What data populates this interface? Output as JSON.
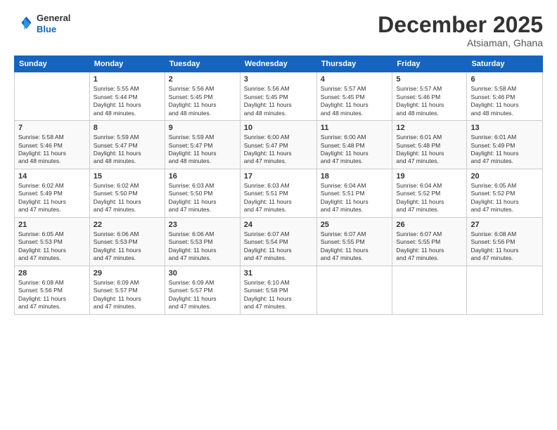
{
  "logo": {
    "line1": "General",
    "line2": "Blue"
  },
  "title": "December 2025",
  "subtitle": "Atsiaman, Ghana",
  "days_of_week": [
    "Sunday",
    "Monday",
    "Tuesday",
    "Wednesday",
    "Thursday",
    "Friday",
    "Saturday"
  ],
  "weeks": [
    [
      {
        "day": "",
        "info": ""
      },
      {
        "day": "1",
        "info": "Sunrise: 5:55 AM\nSunset: 5:44 PM\nDaylight: 11 hours\nand 48 minutes."
      },
      {
        "day": "2",
        "info": "Sunrise: 5:56 AM\nSunset: 5:45 PM\nDaylight: 11 hours\nand 48 minutes."
      },
      {
        "day": "3",
        "info": "Sunrise: 5:56 AM\nSunset: 5:45 PM\nDaylight: 11 hours\nand 48 minutes."
      },
      {
        "day": "4",
        "info": "Sunrise: 5:57 AM\nSunset: 5:45 PM\nDaylight: 11 hours\nand 48 minutes."
      },
      {
        "day": "5",
        "info": "Sunrise: 5:57 AM\nSunset: 5:46 PM\nDaylight: 11 hours\nand 48 minutes."
      },
      {
        "day": "6",
        "info": "Sunrise: 5:58 AM\nSunset: 5:46 PM\nDaylight: 11 hours\nand 48 minutes."
      }
    ],
    [
      {
        "day": "7",
        "info": "Sunrise: 5:58 AM\nSunset: 5:46 PM\nDaylight: 11 hours\nand 48 minutes."
      },
      {
        "day": "8",
        "info": "Sunrise: 5:59 AM\nSunset: 5:47 PM\nDaylight: 11 hours\nand 48 minutes."
      },
      {
        "day": "9",
        "info": "Sunrise: 5:59 AM\nSunset: 5:47 PM\nDaylight: 11 hours\nand 48 minutes."
      },
      {
        "day": "10",
        "info": "Sunrise: 6:00 AM\nSunset: 5:47 PM\nDaylight: 11 hours\nand 47 minutes."
      },
      {
        "day": "11",
        "info": "Sunrise: 6:00 AM\nSunset: 5:48 PM\nDaylight: 11 hours\nand 47 minutes."
      },
      {
        "day": "12",
        "info": "Sunrise: 6:01 AM\nSunset: 5:48 PM\nDaylight: 11 hours\nand 47 minutes."
      },
      {
        "day": "13",
        "info": "Sunrise: 6:01 AM\nSunset: 5:49 PM\nDaylight: 11 hours\nand 47 minutes."
      }
    ],
    [
      {
        "day": "14",
        "info": "Sunrise: 6:02 AM\nSunset: 5:49 PM\nDaylight: 11 hours\nand 47 minutes."
      },
      {
        "day": "15",
        "info": "Sunrise: 6:02 AM\nSunset: 5:50 PM\nDaylight: 11 hours\nand 47 minutes."
      },
      {
        "day": "16",
        "info": "Sunrise: 6:03 AM\nSunset: 5:50 PM\nDaylight: 11 hours\nand 47 minutes."
      },
      {
        "day": "17",
        "info": "Sunrise: 6:03 AM\nSunset: 5:51 PM\nDaylight: 11 hours\nand 47 minutes."
      },
      {
        "day": "18",
        "info": "Sunrise: 6:04 AM\nSunset: 5:51 PM\nDaylight: 11 hours\nand 47 minutes."
      },
      {
        "day": "19",
        "info": "Sunrise: 6:04 AM\nSunset: 5:52 PM\nDaylight: 11 hours\nand 47 minutes."
      },
      {
        "day": "20",
        "info": "Sunrise: 6:05 AM\nSunset: 5:52 PM\nDaylight: 11 hours\nand 47 minutes."
      }
    ],
    [
      {
        "day": "21",
        "info": "Sunrise: 6:05 AM\nSunset: 5:53 PM\nDaylight: 11 hours\nand 47 minutes."
      },
      {
        "day": "22",
        "info": "Sunrise: 6:06 AM\nSunset: 5:53 PM\nDaylight: 11 hours\nand 47 minutes."
      },
      {
        "day": "23",
        "info": "Sunrise: 6:06 AM\nSunset: 5:53 PM\nDaylight: 11 hours\nand 47 minutes."
      },
      {
        "day": "24",
        "info": "Sunrise: 6:07 AM\nSunset: 5:54 PM\nDaylight: 11 hours\nand 47 minutes."
      },
      {
        "day": "25",
        "info": "Sunrise: 6:07 AM\nSunset: 5:55 PM\nDaylight: 11 hours\nand 47 minutes."
      },
      {
        "day": "26",
        "info": "Sunrise: 6:07 AM\nSunset: 5:55 PM\nDaylight: 11 hours\nand 47 minutes."
      },
      {
        "day": "27",
        "info": "Sunrise: 6:08 AM\nSunset: 5:56 PM\nDaylight: 11 hours\nand 47 minutes."
      }
    ],
    [
      {
        "day": "28",
        "info": "Sunrise: 6:08 AM\nSunset: 5:56 PM\nDaylight: 11 hours\nand 47 minutes."
      },
      {
        "day": "29",
        "info": "Sunrise: 6:09 AM\nSunset: 5:57 PM\nDaylight: 11 hours\nand 47 minutes."
      },
      {
        "day": "30",
        "info": "Sunrise: 6:09 AM\nSunset: 5:57 PM\nDaylight: 11 hours\nand 47 minutes."
      },
      {
        "day": "31",
        "info": "Sunrise: 6:10 AM\nSunset: 5:58 PM\nDaylight: 11 hours\nand 47 minutes."
      },
      {
        "day": "",
        "info": ""
      },
      {
        "day": "",
        "info": ""
      },
      {
        "day": "",
        "info": ""
      }
    ]
  ]
}
